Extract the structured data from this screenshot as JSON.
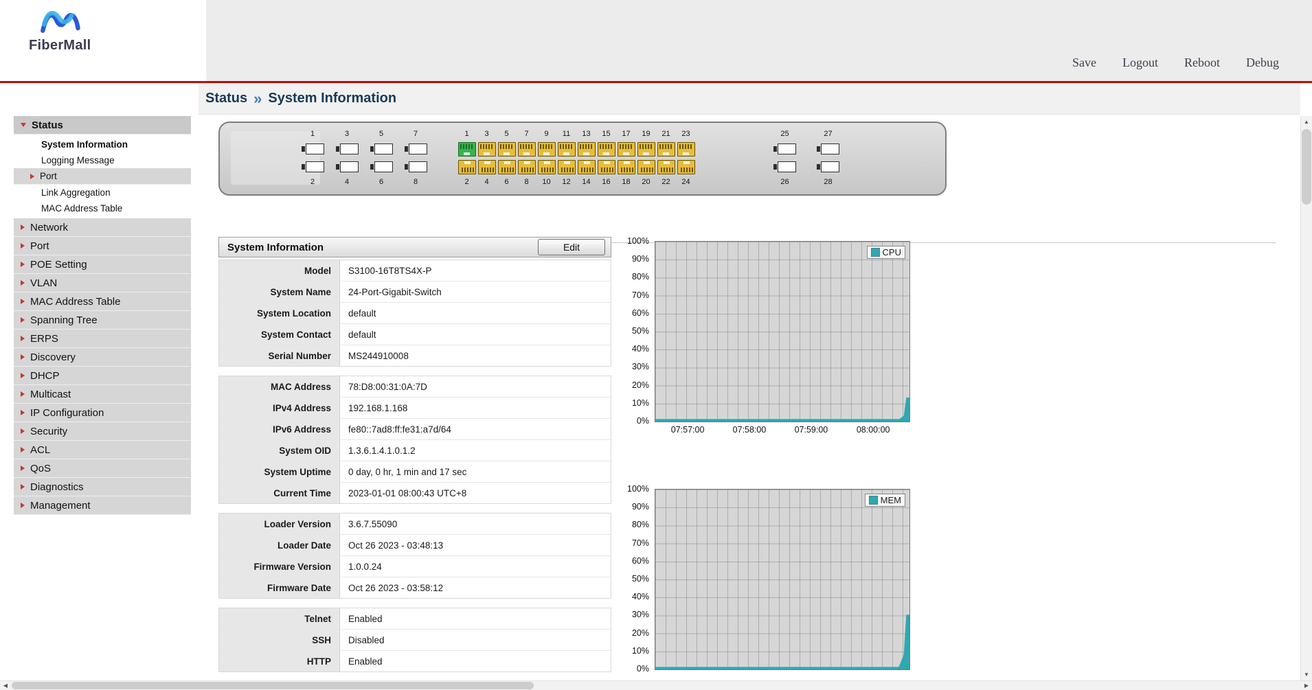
{
  "brand": {
    "name": "FiberMall"
  },
  "header": {
    "links": [
      {
        "label": "Save"
      },
      {
        "label": "Logout"
      },
      {
        "label": "Reboot"
      },
      {
        "label": "Debug"
      }
    ]
  },
  "breadcrumb": {
    "section": "Status",
    "separator": "»",
    "page": "System Information"
  },
  "sidebar": {
    "items": [
      {
        "label": "Status",
        "selected": true,
        "expanded": true,
        "children": [
          {
            "label": "System Information",
            "selected": true
          },
          {
            "label": "Logging Message"
          },
          {
            "label": "Port",
            "submenu": true
          },
          {
            "label": "Link Aggregation"
          },
          {
            "label": "MAC Address Table"
          }
        ]
      },
      {
        "label": "Network"
      },
      {
        "label": "Port"
      },
      {
        "label": "POE Setting"
      },
      {
        "label": "VLAN"
      },
      {
        "label": "MAC Address Table"
      },
      {
        "label": "Spanning Tree"
      },
      {
        "label": "ERPS"
      },
      {
        "label": "Discovery"
      },
      {
        "label": "DHCP"
      },
      {
        "label": "Multicast"
      },
      {
        "label": "IP Configuration"
      },
      {
        "label": "Security"
      },
      {
        "label": "ACL"
      },
      {
        "label": "QoS"
      },
      {
        "label": "Diagnostics"
      },
      {
        "label": "Management"
      }
    ]
  },
  "device_panel": {
    "groups": [
      {
        "kind": "sfp",
        "top_labels": [
          "1",
          "3",
          "5",
          "7"
        ],
        "bottom_labels": [
          "2",
          "4",
          "6",
          "8"
        ]
      },
      {
        "kind": "copper",
        "top_labels": [
          "1",
          "3",
          "5",
          "7",
          "9",
          "11",
          "13",
          "15",
          "17",
          "19",
          "21",
          "23"
        ],
        "bottom_labels": [
          "2",
          "4",
          "6",
          "8",
          "10",
          "12",
          "14",
          "16",
          "18",
          "20",
          "22",
          "24"
        ],
        "link_up_top": [
          "1"
        ]
      },
      {
        "kind": "sfp",
        "top_labels": [
          "25",
          "27"
        ],
        "bottom_labels": [
          "26",
          "28"
        ]
      }
    ]
  },
  "system_info": {
    "title": "System Information",
    "edit_button": "Edit",
    "groups": [
      [
        {
          "label": "Model",
          "value": "S3100-16T8TS4X-P"
        },
        {
          "label": "System Name",
          "value": "24-Port-Gigabit-Switch"
        },
        {
          "label": "System Location",
          "value": "default"
        },
        {
          "label": "System Contact",
          "value": "default"
        },
        {
          "label": "Serial Number",
          "value": "MS244910008"
        }
      ],
      [
        {
          "label": "MAC Address",
          "value": "78:D8:00:31:0A:7D"
        },
        {
          "label": "IPv4 Address",
          "value": "192.168.1.168"
        },
        {
          "label": "IPv6 Address",
          "value": "fe80::7ad8:ff:fe31:a7d/64"
        },
        {
          "label": "System OID",
          "value": "1.3.6.1.4.1.0.1.2"
        },
        {
          "label": "System Uptime",
          "value": "0 day, 0 hr, 1 min and 17 sec"
        },
        {
          "label": "Current Time",
          "value": "2023-01-01 08:00:43 UTC+8"
        }
      ],
      [
        {
          "label": "Loader Version",
          "value": "3.6.7.55090"
        },
        {
          "label": "Loader Date",
          "value": "Oct 26 2023 - 03:48:13"
        },
        {
          "label": "Firmware Version",
          "value": "1.0.0.24"
        },
        {
          "label": "Firmware Date",
          "value": "Oct 26 2023 - 03:58:12"
        }
      ],
      [
        {
          "label": "Telnet",
          "value": "Enabled"
        },
        {
          "label": "SSH",
          "value": "Disabled"
        },
        {
          "label": "HTTP",
          "value": "Enabled"
        }
      ]
    ]
  },
  "chart_data": [
    {
      "type": "area",
      "name": "cpu-usage",
      "legend": "CPU",
      "series_color": "#2fa8b0",
      "ylim": [
        0,
        100
      ],
      "grid": true,
      "legend_position": "top-right",
      "y_ticks": [
        "100%",
        "90%",
        "80%",
        "70%",
        "60%",
        "50%",
        "40%",
        "30%",
        "20%",
        "10%",
        "0%"
      ],
      "x_ticks": [
        "07:57:00",
        "07:58:00",
        "07:59:00",
        "08:00:00"
      ],
      "x_tick_pos_pct": [
        13,
        37.3,
        61.6,
        86
      ],
      "points": [
        [
          0,
          1
        ],
        [
          96,
          1
        ],
        [
          98,
          3
        ],
        [
          99,
          13
        ],
        [
          100,
          13
        ]
      ]
    },
    {
      "type": "area",
      "name": "memory-usage",
      "legend": "MEM",
      "series_color": "#2fa8b0",
      "ylim": [
        0,
        100
      ],
      "grid": true,
      "legend_position": "top-right",
      "y_ticks": [
        "100%",
        "90%",
        "80%",
        "70%",
        "60%",
        "50%",
        "40%",
        "30%",
        "20%",
        "10%",
        "0%"
      ],
      "x_ticks": [],
      "x_tick_pos_pct": [],
      "points": [
        [
          0,
          1
        ],
        [
          96,
          1
        ],
        [
          98,
          8
        ],
        [
          99,
          30
        ],
        [
          100,
          30
        ]
      ]
    }
  ],
  "colors": {
    "accent_red": "#c00a0a",
    "series_teal": "#2fa8b0",
    "port_active_green": "#35b54b",
    "port_copper_yellow": "#e7bd3d"
  },
  "icons": {
    "scroll_up": "▲",
    "scroll_down": "▼",
    "scroll_left": "◀",
    "scroll_right": "▶"
  }
}
